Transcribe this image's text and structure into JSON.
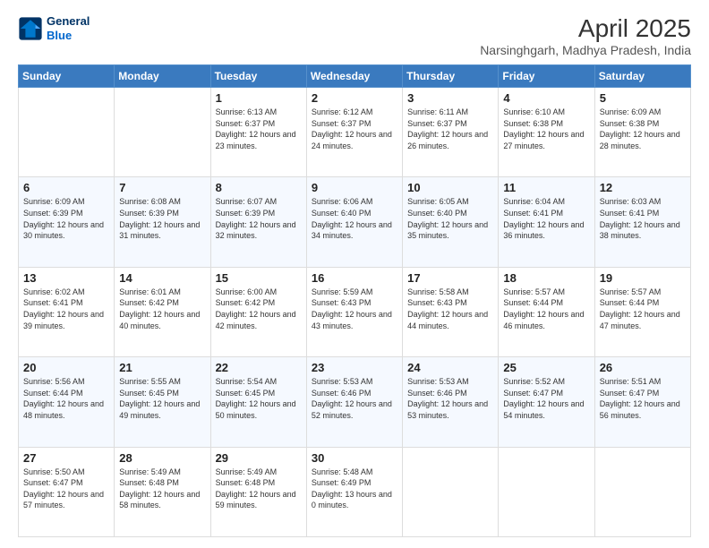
{
  "header": {
    "logo_line1": "General",
    "logo_line2": "Blue",
    "title": "April 2025",
    "subtitle": "Narsinghgarh, Madhya Pradesh, India"
  },
  "weekdays": [
    "Sunday",
    "Monday",
    "Tuesday",
    "Wednesday",
    "Thursday",
    "Friday",
    "Saturday"
  ],
  "weeks": [
    [
      {
        "day": "",
        "info": ""
      },
      {
        "day": "",
        "info": ""
      },
      {
        "day": "1",
        "info": "Sunrise: 6:13 AM\nSunset: 6:37 PM\nDaylight: 12 hours and 23 minutes."
      },
      {
        "day": "2",
        "info": "Sunrise: 6:12 AM\nSunset: 6:37 PM\nDaylight: 12 hours and 24 minutes."
      },
      {
        "day": "3",
        "info": "Sunrise: 6:11 AM\nSunset: 6:37 PM\nDaylight: 12 hours and 26 minutes."
      },
      {
        "day": "4",
        "info": "Sunrise: 6:10 AM\nSunset: 6:38 PM\nDaylight: 12 hours and 27 minutes."
      },
      {
        "day": "5",
        "info": "Sunrise: 6:09 AM\nSunset: 6:38 PM\nDaylight: 12 hours and 28 minutes."
      }
    ],
    [
      {
        "day": "6",
        "info": "Sunrise: 6:09 AM\nSunset: 6:39 PM\nDaylight: 12 hours and 30 minutes."
      },
      {
        "day": "7",
        "info": "Sunrise: 6:08 AM\nSunset: 6:39 PM\nDaylight: 12 hours and 31 minutes."
      },
      {
        "day": "8",
        "info": "Sunrise: 6:07 AM\nSunset: 6:39 PM\nDaylight: 12 hours and 32 minutes."
      },
      {
        "day": "9",
        "info": "Sunrise: 6:06 AM\nSunset: 6:40 PM\nDaylight: 12 hours and 34 minutes."
      },
      {
        "day": "10",
        "info": "Sunrise: 6:05 AM\nSunset: 6:40 PM\nDaylight: 12 hours and 35 minutes."
      },
      {
        "day": "11",
        "info": "Sunrise: 6:04 AM\nSunset: 6:41 PM\nDaylight: 12 hours and 36 minutes."
      },
      {
        "day": "12",
        "info": "Sunrise: 6:03 AM\nSunset: 6:41 PM\nDaylight: 12 hours and 38 minutes."
      }
    ],
    [
      {
        "day": "13",
        "info": "Sunrise: 6:02 AM\nSunset: 6:41 PM\nDaylight: 12 hours and 39 minutes."
      },
      {
        "day": "14",
        "info": "Sunrise: 6:01 AM\nSunset: 6:42 PM\nDaylight: 12 hours and 40 minutes."
      },
      {
        "day": "15",
        "info": "Sunrise: 6:00 AM\nSunset: 6:42 PM\nDaylight: 12 hours and 42 minutes."
      },
      {
        "day": "16",
        "info": "Sunrise: 5:59 AM\nSunset: 6:43 PM\nDaylight: 12 hours and 43 minutes."
      },
      {
        "day": "17",
        "info": "Sunrise: 5:58 AM\nSunset: 6:43 PM\nDaylight: 12 hours and 44 minutes."
      },
      {
        "day": "18",
        "info": "Sunrise: 5:57 AM\nSunset: 6:44 PM\nDaylight: 12 hours and 46 minutes."
      },
      {
        "day": "19",
        "info": "Sunrise: 5:57 AM\nSunset: 6:44 PM\nDaylight: 12 hours and 47 minutes."
      }
    ],
    [
      {
        "day": "20",
        "info": "Sunrise: 5:56 AM\nSunset: 6:44 PM\nDaylight: 12 hours and 48 minutes."
      },
      {
        "day": "21",
        "info": "Sunrise: 5:55 AM\nSunset: 6:45 PM\nDaylight: 12 hours and 49 minutes."
      },
      {
        "day": "22",
        "info": "Sunrise: 5:54 AM\nSunset: 6:45 PM\nDaylight: 12 hours and 50 minutes."
      },
      {
        "day": "23",
        "info": "Sunrise: 5:53 AM\nSunset: 6:46 PM\nDaylight: 12 hours and 52 minutes."
      },
      {
        "day": "24",
        "info": "Sunrise: 5:53 AM\nSunset: 6:46 PM\nDaylight: 12 hours and 53 minutes."
      },
      {
        "day": "25",
        "info": "Sunrise: 5:52 AM\nSunset: 6:47 PM\nDaylight: 12 hours and 54 minutes."
      },
      {
        "day": "26",
        "info": "Sunrise: 5:51 AM\nSunset: 6:47 PM\nDaylight: 12 hours and 56 minutes."
      }
    ],
    [
      {
        "day": "27",
        "info": "Sunrise: 5:50 AM\nSunset: 6:47 PM\nDaylight: 12 hours and 57 minutes."
      },
      {
        "day": "28",
        "info": "Sunrise: 5:49 AM\nSunset: 6:48 PM\nDaylight: 12 hours and 58 minutes."
      },
      {
        "day": "29",
        "info": "Sunrise: 5:49 AM\nSunset: 6:48 PM\nDaylight: 12 hours and 59 minutes."
      },
      {
        "day": "30",
        "info": "Sunrise: 5:48 AM\nSunset: 6:49 PM\nDaylight: 13 hours and 0 minutes."
      },
      {
        "day": "",
        "info": ""
      },
      {
        "day": "",
        "info": ""
      },
      {
        "day": "",
        "info": ""
      }
    ]
  ]
}
